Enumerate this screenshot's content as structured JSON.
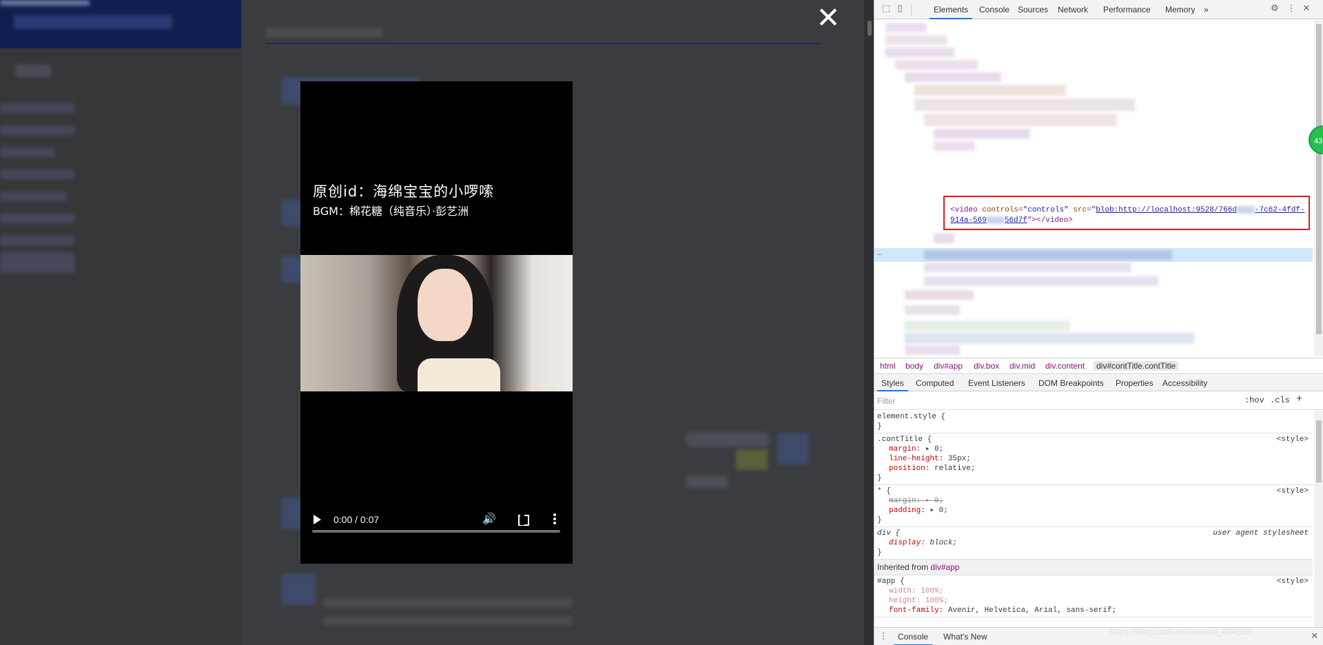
{
  "overlay": {
    "close_glyph": "✕",
    "video": {
      "title": "原创id：海绵宝宝的小啰嗦",
      "subtitle": "BGM：棉花糖（纯音乐）·彭艺洲",
      "time": "0:00 / 0:07",
      "progress_fraction": 0,
      "volume_glyph": "🔊"
    }
  },
  "devtools": {
    "toolbar_icons": [
      "inspect-icon",
      "device-toggle-icon"
    ],
    "tabs": [
      "Elements",
      "Console",
      "Sources",
      "Network",
      "Performance",
      "Memory",
      "»"
    ],
    "active_tab": "Elements",
    "video_element": {
      "open_tag": "<video",
      "attr1": "controls",
      "val1": "\"controls\"",
      "attr2": "src",
      "src_value": "blob:http://localhost:9528/766d",
      "src_value_2": "-7c62-4fdf-",
      "src_value_3": "914a-569",
      "src_value_4": "56d7f",
      "close_tag": "\"></video>"
    },
    "ellipsis": "…",
    "breadcrumbs": [
      "html",
      "body",
      "div#app",
      "div.box",
      "div.mid",
      "div.content",
      "div#contTitle.contTitle"
    ],
    "sub_tabs": [
      "Styles",
      "Computed",
      "Event Listeners",
      "DOM Breakpoints",
      "Properties",
      "Accessibility"
    ],
    "filter": {
      "placeholder": "Filter",
      "hov": ":hov",
      "cls": ".cls",
      "plus": "+"
    },
    "styles": {
      "element_style": "element.style {",
      "close_brace": "}",
      "rule1": {
        "selector": ".contTitle",
        "source": "<style>",
        "props": [
          {
            "name": "margin",
            "value": "▸ 0;"
          },
          {
            "name": "line-height",
            "value": "35px;"
          },
          {
            "name": "position",
            "value": "relative;"
          }
        ]
      },
      "rule2": {
        "selector": "*",
        "source": "<style>",
        "props": [
          {
            "name": "margin",
            "value": "▸ 0;"
          },
          {
            "name": "padding",
            "value": "▸ 0;"
          }
        ]
      },
      "rule3": {
        "selector": "div",
        "source": "user agent stylesheet",
        "props": [
          {
            "name": "display",
            "value": "block;"
          }
        ]
      },
      "inherited_label": "Inherited from",
      "inherited_from": "div#app",
      "rule4": {
        "selector": "#app",
        "source": "<style>",
        "props": [
          {
            "name": "width",
            "value": "100%;"
          },
          {
            "name": "height",
            "value": "100%;"
          },
          {
            "name": "font-family",
            "value": "Avenir, Helvetica, Arial, sans-serif;"
          }
        ]
      }
    },
    "drawer_tabs": [
      "Console",
      "What's New"
    ],
    "drawer_close": "✕",
    "badge": "43"
  },
  "watermark": "https://blog.csdn.net/weixin_454555"
}
